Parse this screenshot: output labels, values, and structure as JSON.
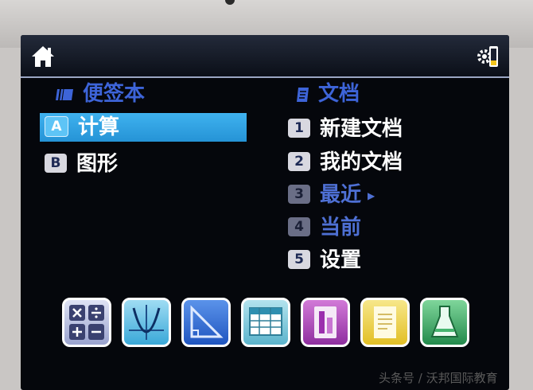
{
  "left_section": {
    "title": "便签本",
    "items": [
      {
        "key": "A",
        "label": "计算",
        "selected": true
      },
      {
        "key": "B",
        "label": "图形",
        "selected": false
      }
    ]
  },
  "right_section": {
    "title": "文档",
    "items": [
      {
        "key": "1",
        "label": "新建文档",
        "enabled": true
      },
      {
        "key": "2",
        "label": "我的文档",
        "enabled": true
      },
      {
        "key": "3",
        "label": "最近",
        "enabled": false,
        "has_submenu": true
      },
      {
        "key": "4",
        "label": "当前",
        "enabled": false
      },
      {
        "key": "5",
        "label": "设置",
        "enabled": true
      }
    ]
  },
  "topbar": {
    "left_icon": "home-icon",
    "right_icon": "battery-settings-icon"
  },
  "app_dock": [
    {
      "name": "calculator-app",
      "icon": "calculator-icon",
      "color": "#c7cde8"
    },
    {
      "name": "graphs-app",
      "icon": "graph-icon",
      "color": "#6fc6ea"
    },
    {
      "name": "geometry-app",
      "icon": "geometry-icon",
      "color": "#2f6fd8"
    },
    {
      "name": "lists-spreadsheet-app",
      "icon": "spreadsheet-icon",
      "color": "#7fc7dc"
    },
    {
      "name": "data-statistics-app",
      "icon": "data-icon",
      "color": "#b44bbd"
    },
    {
      "name": "notes-app",
      "icon": "notes-icon",
      "color": "#f2d84b"
    },
    {
      "name": "vernier-dataquest-app",
      "icon": "dataquest-icon",
      "color": "#3fa66a"
    }
  ],
  "watermark": "头条号 / 沃邦国际教育",
  "colors": {
    "screen_bg": "#05070c",
    "accent_title": "#3d64d8",
    "selection": "#2fa3e4"
  }
}
